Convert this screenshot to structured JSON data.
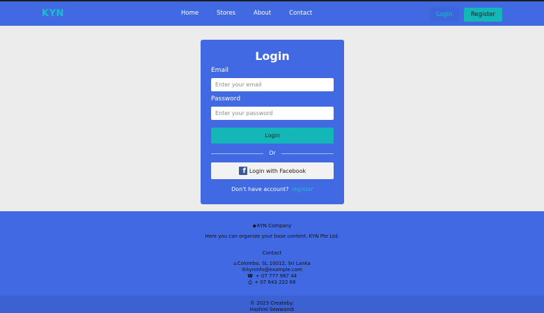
{
  "nav": {
    "brand": "KYN",
    "links": [
      "Home",
      "Stores",
      "About",
      "Contact"
    ],
    "login_label": "Login",
    "register_label": "Register"
  },
  "login_card": {
    "title": "Login",
    "email_label": "Email",
    "email_placeholder": "Enter your email",
    "email_value": "",
    "password_label": "Password",
    "password_placeholder": "Enter your password",
    "password_value": "",
    "submit_label": "Login",
    "divider_text": "Or",
    "facebook_label": "Login with Facebook",
    "signup_prompt": "Don't have account?",
    "signup_link": "register"
  },
  "footer": {
    "company": "KYN Company",
    "tagline": "Here you can organize your base content. KYN Pte Ltd.",
    "contact_heading": "Contact",
    "address": "Colombo, SL 10012, Sri Lanka",
    "email": "kyninfo@example.com",
    "phone": "+ 07 777 987 44",
    "fax": "+ 07 643 222 68",
    "copyright_line1": "© 2023 Createby:",
    "copyright_line2": "Hashini Sewwandi"
  },
  "colors": {
    "primary": "#4169e1",
    "accent": "#14b6b7",
    "background": "#ececec"
  },
  "icons": {
    "company": "gem-icon",
    "address": "home-icon",
    "email": "envelope-icon",
    "phone": "phone-icon",
    "fax": "printer-icon",
    "facebook": "facebook-icon"
  }
}
